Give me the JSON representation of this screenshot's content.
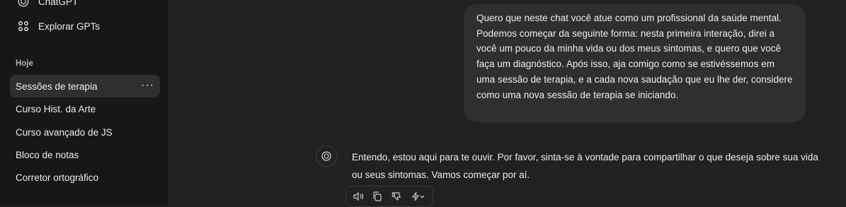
{
  "sidebar": {
    "top_items": [
      {
        "label": "ChatGPT",
        "icon": "openai-logo-icon"
      },
      {
        "label": "Explorar GPTs",
        "icon": "grid-icon"
      }
    ],
    "section_label": "Hoje",
    "history": [
      {
        "label": "Sessões de terapia",
        "active": true
      },
      {
        "label": "Curso Hist. da Arte",
        "active": false
      },
      {
        "label": "Curso avançado de JS",
        "active": false
      },
      {
        "label": "Bloco de notas",
        "active": false
      },
      {
        "label": "Corretor ortográfico",
        "active": false
      }
    ],
    "more_glyph": "···"
  },
  "chat": {
    "user_message": "Quero que neste chat você atue como um profissional da saúde mental. Podemos começar da seguinte forma: nesta primeira interação, direi a você um pouco da minha vida ou dos meus sintomas, e quero que você faça um diagnóstico. Após isso, aja comigo como se estivéssemos em uma sessão de terapia, e a cada nova saudação que eu lhe der, considere como uma nova sessão de terapia se iniciando.",
    "assistant_message": "Entendo, estou aqui para te ouvir. Por favor, sinta-se à vontade para compartilhar o que deseja sobre sua vida ou seus sintomas. Vamos começar por aí.",
    "actions": [
      "read-aloud-icon",
      "copy-icon",
      "thumbs-down-icon",
      "regenerate-icon"
    ]
  },
  "colors": {
    "background": "#212121",
    "sidebar": "#171717",
    "bubble": "#2f2f2f",
    "text": "#ececec"
  }
}
